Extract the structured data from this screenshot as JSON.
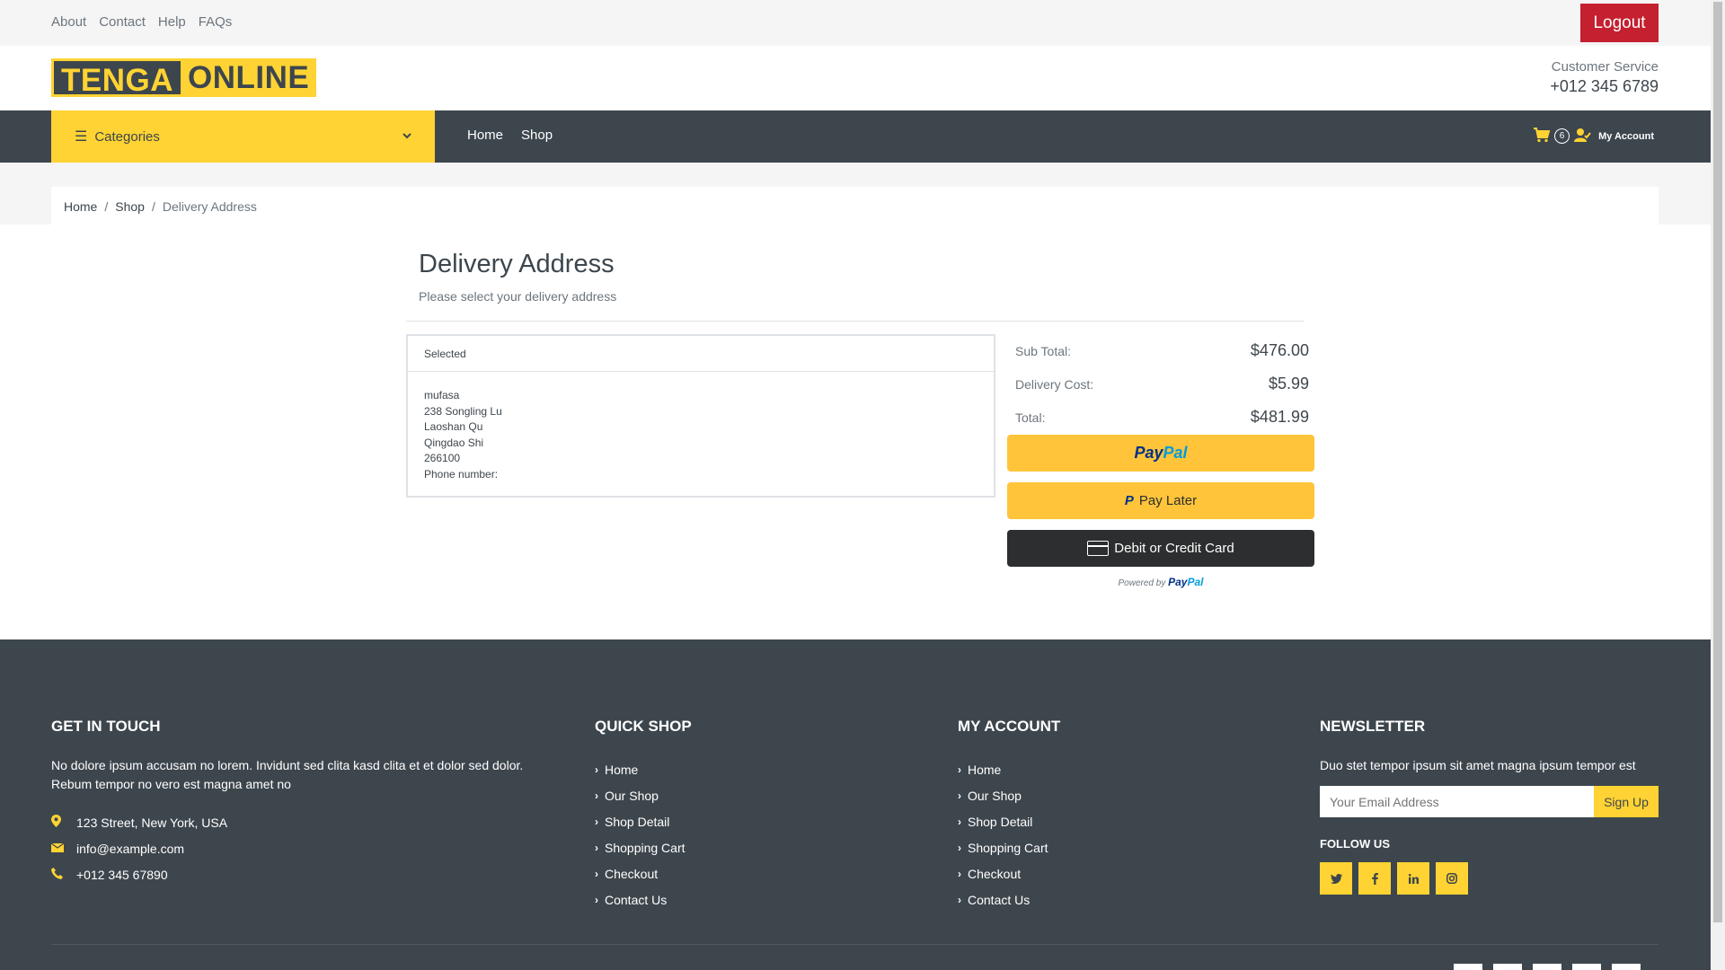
{
  "topbar": {
    "links": [
      "About",
      "Contact",
      "Help",
      "FAQs"
    ],
    "logout": "Logout"
  },
  "header": {
    "logo_part1": "TENGA",
    "logo_part2": "ONLINE",
    "cs_label": "Customer Service",
    "cs_phone": "+012 345 6789"
  },
  "nav": {
    "categories": "Categories",
    "links": [
      "Home",
      "Shop"
    ],
    "cart_count": "6",
    "account": "My Account"
  },
  "breadcrumb": {
    "items": [
      "Home",
      "Shop"
    ],
    "active": "Delivery Address"
  },
  "main": {
    "title": "Delivery Address",
    "subtitle": "Please select your delivery address",
    "address": {
      "header": "Selected",
      "lines": [
        "mufasa",
        "238 Songling Lu",
        "Laoshan Qu",
        "Qingdao Shi",
        "266100",
        "Phone number:"
      ]
    }
  },
  "summary": {
    "subtotal_label": "Sub Total:",
    "subtotal_value": "$476.00",
    "delivery_label": "Delivery Cost:",
    "delivery_value": "$5.99",
    "total_label": "Total:",
    "total_value": "$481.99",
    "paypal_a": "Pay",
    "paypal_b": "Pal",
    "pay_later": "Pay Later",
    "card": "Debit or Credit Card",
    "powered_by": "Powered by"
  },
  "footer": {
    "touch": {
      "title": "GET IN TOUCH",
      "text": "No dolore ipsum accusam no lorem. Invidunt sed clita kasd clita et et dolor sed dolor. Rebum tempor no vero est magna amet no",
      "address": "123 Street, New York, USA",
      "email": "info@example.com",
      "phone": "+012 345 67890"
    },
    "quick_shop": {
      "title": "QUICK SHOP",
      "items": [
        "Home",
        "Our Shop",
        "Shop Detail",
        "Shopping Cart",
        "Checkout",
        "Contact Us"
      ]
    },
    "my_account": {
      "title": "MY ACCOUNT",
      "items": [
        "Home",
        "Our Shop",
        "Shop Detail",
        "Shopping Cart",
        "Checkout",
        "Contact Us"
      ]
    },
    "newsletter": {
      "title": "NEWSLETTER",
      "text": "Duo stet tempor ipsum sit amet magna ipsum tempor est",
      "placeholder": "Your Email Address",
      "button": "Sign Up",
      "follow": "FOLLOW US"
    }
  },
  "colors": {
    "accent": "#ffd333",
    "dark": "#3d464d",
    "logout": "#c4202f",
    "paypal_yellow": "#ffc439"
  }
}
